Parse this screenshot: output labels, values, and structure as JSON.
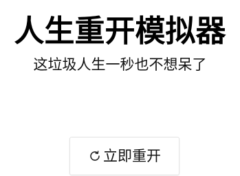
{
  "header": {
    "title": "人生重开模拟器",
    "subtitle": "这垃圾人生一秒也不想呆了"
  },
  "actions": {
    "restart_label": "立即重开",
    "restart_icon": "refresh-icon"
  }
}
